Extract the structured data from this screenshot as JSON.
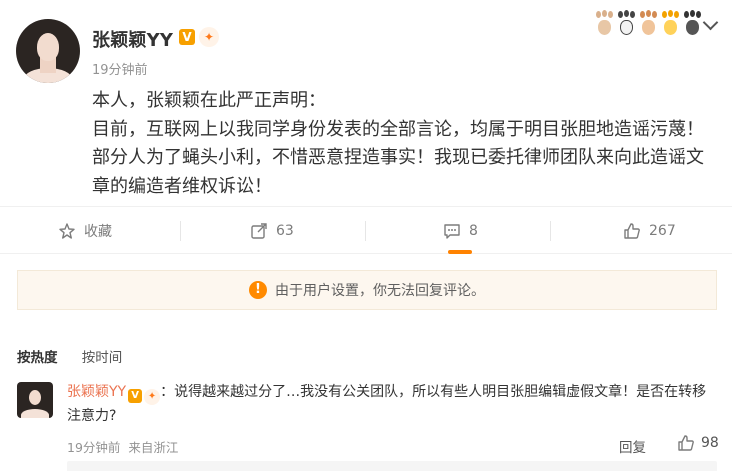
{
  "post": {
    "username": "张颖颖YY",
    "time": "19分钟前",
    "content": [
      "本人，张颖颖在此严正声明：",
      "目前，互联网上以我同学身份发表的全部言论，均属于明目张胆地造谣污蔑！部分人为了蝇头小利，不惜恶意捏造事实！我现已委托律师团队来向此造谣文章的编造者维权诉讼！"
    ]
  },
  "actions": {
    "favorite_label": "收藏",
    "repost_count": "63",
    "comment_count": "8",
    "like_count": "267"
  },
  "notice": {
    "text": "由于用户设置，你无法回复评论。"
  },
  "sort": {
    "hot": "按热度",
    "time": "按时间"
  },
  "comment": {
    "username": "张颖颖YY",
    "text": "：说得越来越过分了…我没有公关团队，所以有些人明目张胆编辑虚假文章！是否在转移注意力?",
    "time": "19分钟前",
    "location": "来自浙江",
    "reply_label": "回复",
    "like_count": "98"
  },
  "colors": {
    "accent": "#ff8200",
    "link": "#eb7350",
    "warning": "#ff8a00"
  }
}
